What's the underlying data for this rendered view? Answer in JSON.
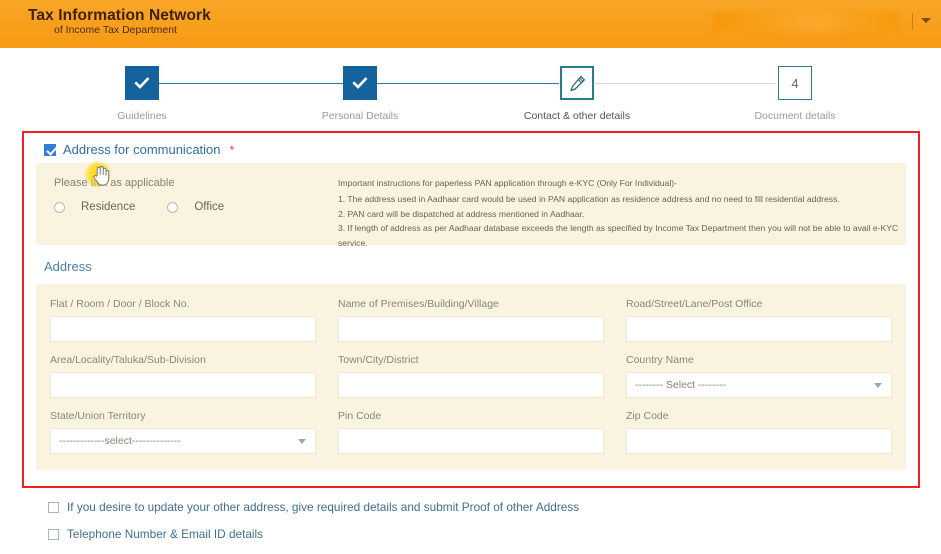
{
  "header": {
    "brand_title": "Tax Information Network",
    "brand_subtitle": "of Income Tax Department",
    "user_name": "",
    "caret_icon": "chevron-down-icon",
    "background_color": "#f79f1f"
  },
  "stepper": {
    "steps": [
      {
        "label": "Guidelines",
        "state": "done",
        "icon": "check-icon",
        "number": "1"
      },
      {
        "label": "Personal Details",
        "state": "done",
        "icon": "check-icon",
        "number": "2"
      },
      {
        "label": "Contact & other details",
        "state": "current",
        "icon": "pencil-icon",
        "number": "3"
      },
      {
        "label": "Document details",
        "state": "todo",
        "icon": "",
        "number": "4"
      }
    ],
    "done_color": "#15639e",
    "accent_color": "#2b7a8c"
  },
  "communication": {
    "checkbox_checked": true,
    "title": "Address for communication",
    "required_marker": "*",
    "tick_label": "Please tick as applicable",
    "options": [
      {
        "label": "Residence",
        "selected": false
      },
      {
        "label": "Office",
        "selected": false
      }
    ],
    "instructions_heading": "Important instructions for paperless PAN application through e-KYC (Only For Individual)-",
    "instructions": [
      "1. The address used in Aadhaar card would be used in PAN application as residence address and no need to fill residential address.",
      "2. PAN card will be dispatched at address mentioned in Aadhaar.",
      "3. If length of address as per Aadhaar database exceeds the length as specified by Income Tax Department then you will not be able to avail e-KYC service."
    ]
  },
  "address": {
    "heading": "Address",
    "fields": [
      {
        "label": "Flat / Room / Door / Block No.",
        "type": "text",
        "value": "",
        "name": "flat-room-door-block-no"
      },
      {
        "label": "Name of Premises/Building/Village",
        "type": "text",
        "value": "",
        "name": "premises-building-village"
      },
      {
        "label": "Road/Street/Lane/Post Office",
        "type": "text",
        "value": "",
        "name": "road-street-lane-post-office"
      },
      {
        "label": "Area/Locality/Taluka/Sub-Division",
        "type": "text",
        "value": "",
        "name": "area-locality-taluka"
      },
      {
        "label": "Town/City/District",
        "type": "text",
        "value": "",
        "name": "town-city-district"
      },
      {
        "label": "Country Name",
        "type": "select",
        "value": "-------- Select --------",
        "name": "country-name"
      },
      {
        "label": "State/Union Territory",
        "type": "select",
        "value": "-------------select--------------",
        "name": "state-union-territory"
      },
      {
        "label": "Pin Code",
        "type": "text",
        "value": "",
        "name": "pin-code"
      },
      {
        "label": "Zip Code",
        "type": "text",
        "value": "",
        "name": "zip-code"
      }
    ]
  },
  "bottom_sections": [
    {
      "checked": false,
      "label": "If you desire to update your other address, give required details and submit Proof of other Address"
    },
    {
      "checked": false,
      "label": "Telephone Number & Email ID details"
    }
  ],
  "highlight": {
    "border_color": "#ee2222",
    "cursor_icon": "pointer-hand-cursor"
  }
}
